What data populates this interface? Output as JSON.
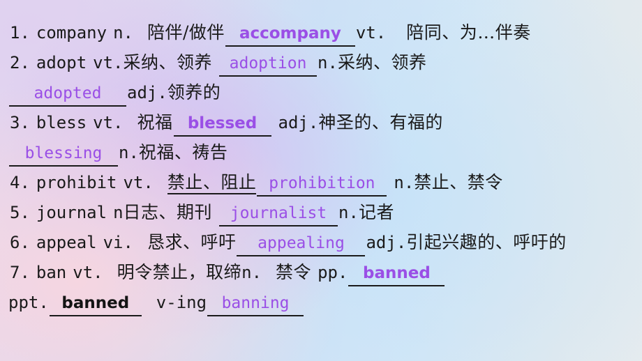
{
  "slide": {
    "background": {
      "accent_purple": "#9a4fe6",
      "text_color": "#1a1a1a",
      "gradient_from": "#e6d9ef",
      "gradient_mid": "#cfe0f5",
      "gradient_to": "#e6ecef"
    }
  },
  "entries": [
    {
      "number": "1.",
      "headword": "company",
      "pos": "n.",
      "gloss": "陪伴/做伴",
      "answer": "accompany",
      "answer_pos": "vt.",
      "answer_gloss": "陪同、为…伴奏"
    },
    {
      "number": "2.",
      "headword": "adopt",
      "pos": "vt.",
      "gloss": "采纳、领养",
      "answer": "adoption",
      "answer_pos": "n.",
      "answer_gloss": "采纳、领养",
      "answer2": "adopted",
      "answer2_pos": "adj.",
      "answer2_gloss": "领养的"
    },
    {
      "number": "3.",
      "headword": "bless",
      "pos": "vt.",
      "gloss": "祝福",
      "answer": "blessed",
      "answer_pos": "adj.",
      "answer_gloss": "神圣的、有福的",
      "answer2": "blessing",
      "answer2_pos": "n.",
      "answer2_gloss": "祝福、祷告"
    },
    {
      "number": "4.",
      "headword": "prohibit",
      "pos": "vt.",
      "gloss": "禁止、阻止",
      "answer": "prohibition",
      "answer_pos": "n.",
      "answer_gloss": "禁止、禁令"
    },
    {
      "number": "5.",
      "headword": "journal",
      "pos": "n",
      "gloss": "日志、期刊",
      "answer": "journalist",
      "answer_pos": "n.",
      "answer_gloss": "记者"
    },
    {
      "number": "6.",
      "headword": "appeal",
      "pos": "vi.",
      "gloss": "恳求、呼吁",
      "answer": "appealing",
      "answer_pos": "adj.",
      "answer_gloss": "引起兴趣的、呼吁的"
    },
    {
      "number": "7.",
      "headword": "ban",
      "pos": "vt.",
      "gloss": "明令禁止，取缔",
      "pos2": "n.",
      "gloss2": "禁令",
      "form_pp_label": "pp.",
      "form_pp": "banned",
      "form_ppt_label": "ppt.",
      "form_ppt": "banned",
      "form_ving_label": "v-ing",
      "form_ving": "banning"
    }
  ]
}
